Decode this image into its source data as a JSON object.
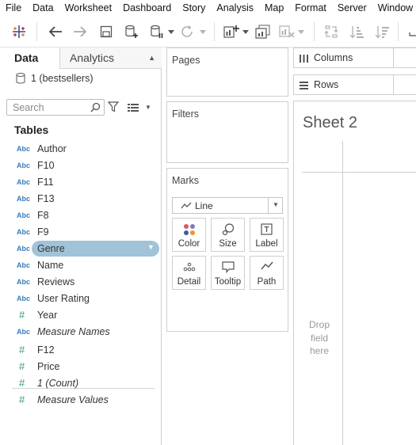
{
  "menu": [
    "File",
    "Data",
    "Worksheet",
    "Dashboard",
    "Story",
    "Analysis",
    "Map",
    "Format",
    "Server",
    "Window"
  ],
  "toolbar": {
    "icons": [
      "tableau-logo-icon",
      "undo-icon",
      "redo-icon",
      "save-icon",
      "new-datasource-icon",
      "pause-updates-icon",
      "refresh-icon",
      "new-worksheet-icon",
      "duplicate-sheet-icon",
      "clear-sheet-icon",
      "swap-rows-columns-icon",
      "sort-ascending-icon",
      "sort-descending-icon"
    ]
  },
  "left": {
    "tab_data": "Data",
    "tab_analytics": "Analytics",
    "datasource": "1 (bestsellers)",
    "search_placeholder": "Search",
    "tables_title": "Tables",
    "dimension_type": "Abc",
    "measure_type": "#",
    "dimensions": [
      {
        "name": "Author",
        "type": "Abc"
      },
      {
        "name": "F10",
        "type": "Abc"
      },
      {
        "name": "F11",
        "type": "Abc"
      },
      {
        "name": "F13",
        "type": "Abc"
      },
      {
        "name": "F8",
        "type": "Abc"
      },
      {
        "name": "F9",
        "type": "Abc"
      },
      {
        "name": "Genre",
        "type": "Abc",
        "selected": true
      },
      {
        "name": "Name",
        "type": "Abc"
      },
      {
        "name": "Reviews",
        "type": "Abc"
      },
      {
        "name": "User Rating",
        "type": "Abc"
      },
      {
        "name": "Year",
        "type": "#"
      },
      {
        "name": "Measure Names",
        "type": "Abc",
        "italic": true
      }
    ],
    "measures": [
      {
        "name": "F12",
        "type": "#"
      },
      {
        "name": "Price",
        "type": "#"
      },
      {
        "name": "1 (Count)",
        "type": "#",
        "italic": true
      },
      {
        "name": "Measure Values",
        "type": "#",
        "italic": true
      }
    ]
  },
  "cards": {
    "pages": "Pages",
    "filters": "Filters",
    "marks": "Marks",
    "mark_type": "Line",
    "mark_buttons": [
      "Color",
      "Size",
      "Label",
      "Detail",
      "Tooltip",
      "Path"
    ]
  },
  "shelves": {
    "columns": "Columns",
    "rows": "Rows"
  },
  "sheet": {
    "title": "Sheet 2",
    "drop_text_1": "Drop",
    "drop_text_2": "field",
    "drop_text_3": "here"
  },
  "colors": {
    "selected_pill": "#a0c3d8",
    "dimension_blue": "#3b7bbd",
    "measure_green": "#3a9a6b"
  }
}
